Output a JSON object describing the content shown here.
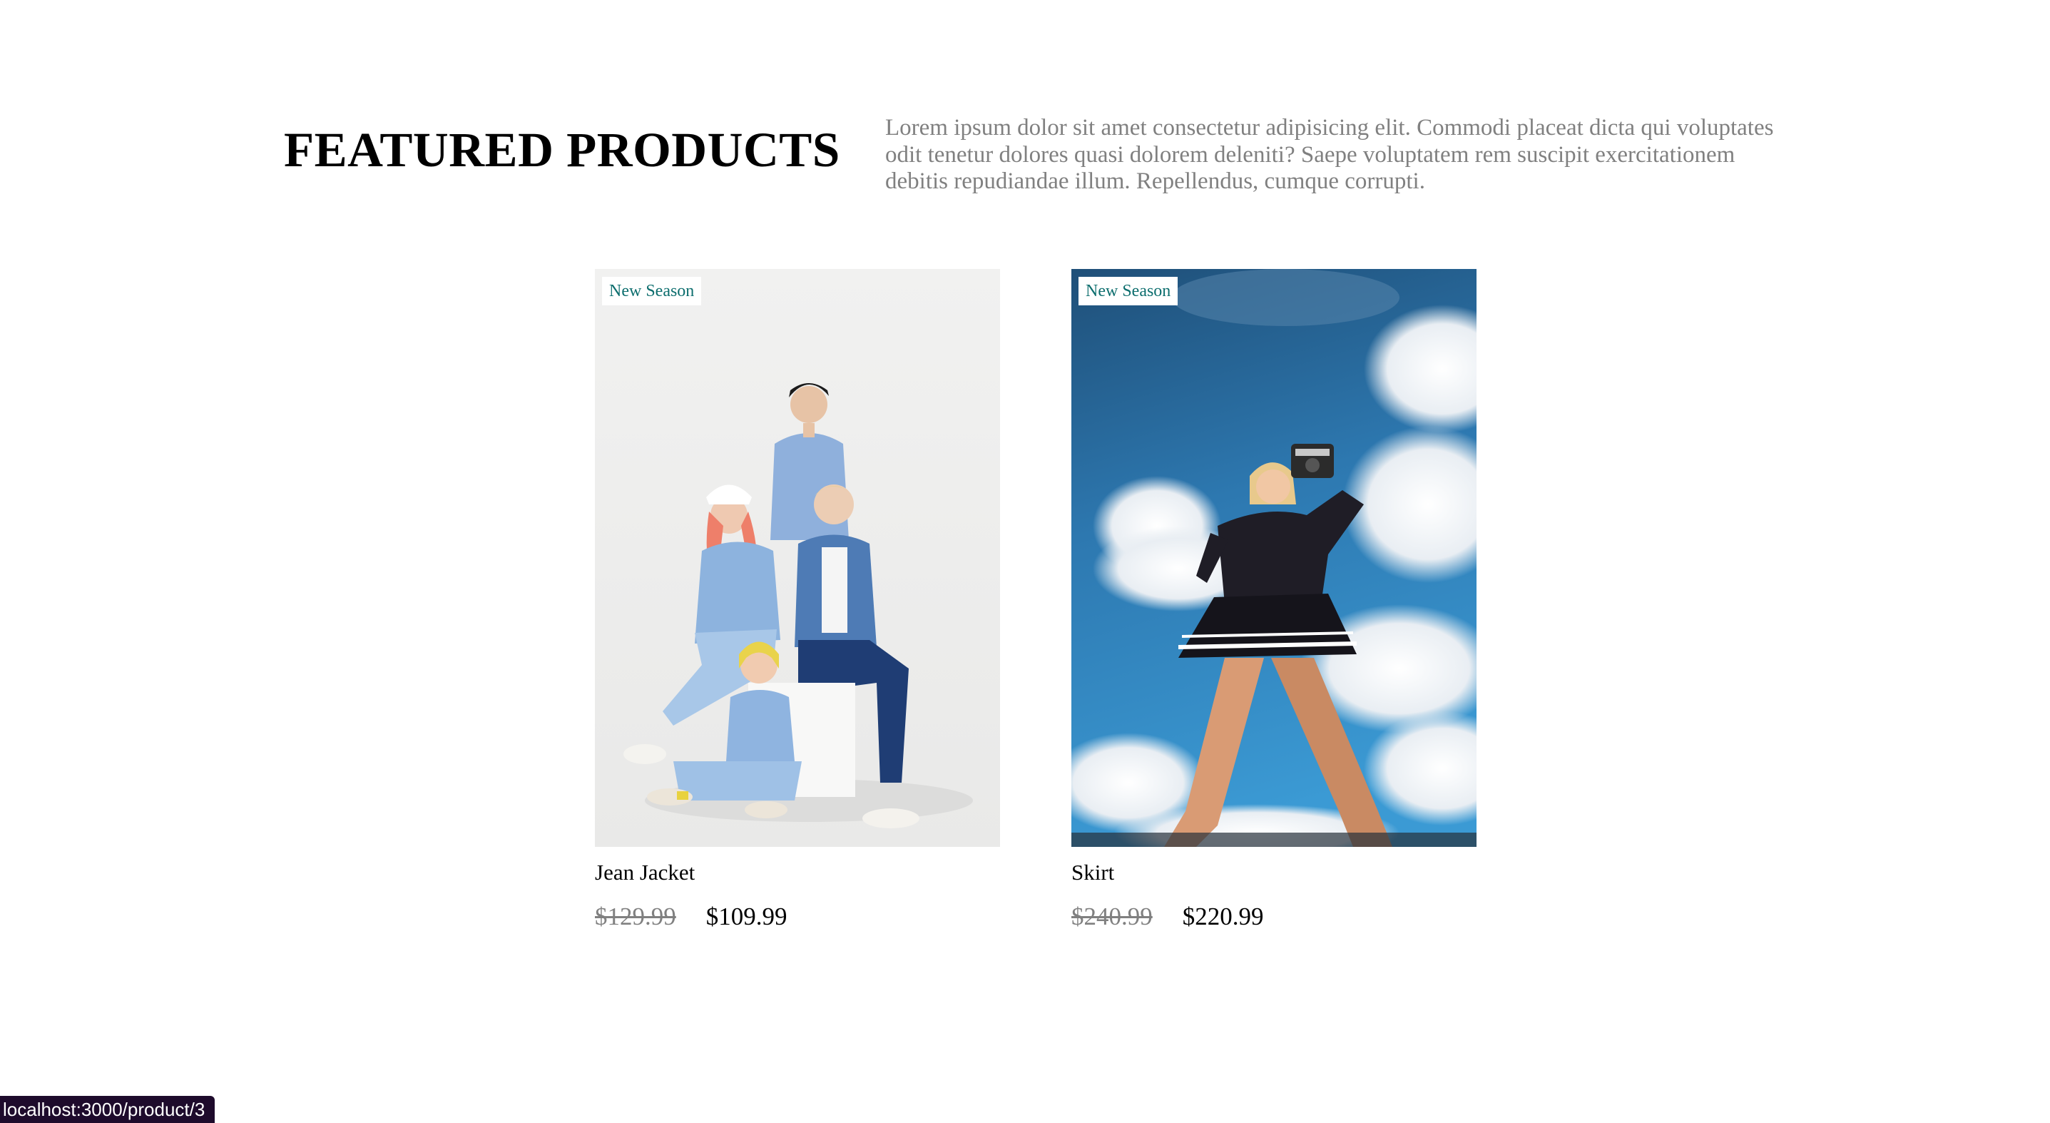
{
  "header": {
    "title": "FEATURED PRODUCTS",
    "description": "Lorem ipsum dolor sit amet consectetur adipisicing elit. Commodi placeat dicta qui voluptates odit tenetur dolores quasi dolorem deleniti? Saepe voluptatem rem suscipit exercitationem debitis repudiandae illum. Repellendus, cumque corrupti."
  },
  "products": [
    {
      "badge": "New Season",
      "name": "Jean Jacket",
      "old_price": "$129.99",
      "price": "$109.99",
      "image": "group-in-denim-outfits-photo"
    },
    {
      "badge": "New Season",
      "name": "Skirt",
      "old_price": "$240.99",
      "price": "$220.99",
      "image": "woman-with-camera-sky-photo"
    }
  ],
  "status_bar": {
    "url": "localhost:3000/product/3"
  },
  "colors": {
    "badge_text": "#0d6e6e",
    "muted_text": "#808080",
    "status_bar_bg": "#1e0b2c"
  }
}
